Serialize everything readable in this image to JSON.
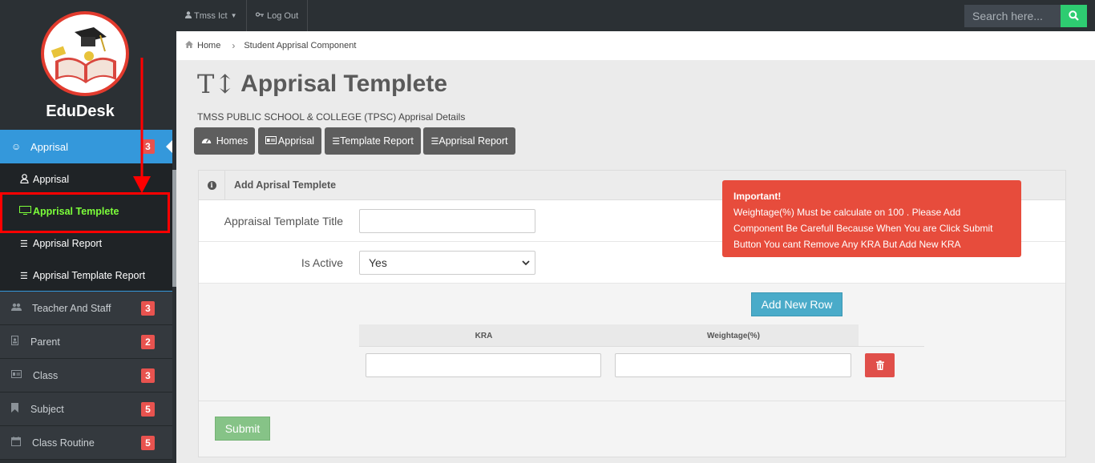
{
  "brand": {
    "name": "EduDesk"
  },
  "sidebar": {
    "active": {
      "label": "Apprisal",
      "badge": "3",
      "icon": "smile-icon"
    },
    "submenu": [
      {
        "label": "Apprisal",
        "icon": "user-icon"
      },
      {
        "label": "Apprisal Templete",
        "icon": "desktop-icon"
      },
      {
        "label": "Apprisal Report",
        "icon": "list-icon"
      },
      {
        "label": "Apprisal Template Report",
        "icon": "list-icon"
      }
    ],
    "items": [
      {
        "label": "Teacher And Staff",
        "badge": "3",
        "icon": "users-icon"
      },
      {
        "label": "Parent",
        "badge": "2",
        "icon": "contact-icon"
      },
      {
        "label": "Class",
        "badge": "3",
        "icon": "id-card-icon"
      },
      {
        "label": "Subject",
        "badge": "5",
        "icon": "bookmark-icon"
      },
      {
        "label": "Class Routine",
        "badge": "5",
        "icon": "calendar-icon"
      }
    ]
  },
  "topbar": {
    "user": "Tmss Ict",
    "logout": "Log Out",
    "search_placeholder": "Search here..."
  },
  "breadcrumb": {
    "home": "Home",
    "current": "Student Apprisal Component"
  },
  "page": {
    "title": "Apprisal Templete",
    "subtitle": "TMSS PUBLIC SCHOOL & COLLEGE (TPSC) Apprisal Details",
    "buttons": [
      "Homes",
      "Apprisal",
      "Template Report",
      "Apprisal Report"
    ]
  },
  "panel": {
    "title": "Add Aprisal Templete",
    "title_label": "Appraisal Template Title",
    "title_value": "",
    "active_label": "Is Active",
    "active_value": "Yes",
    "add_row": "Add New Row",
    "columns": [
      "KRA",
      "Weightage(%)"
    ],
    "submit": "Submit"
  },
  "alert": {
    "heading": "Important!",
    "lines": [
      "Weightage(%) Must be calculate on 100 . Please Add",
      "Component Be Carefull Because When You are Click Submit",
      "Button You cant Remove Any KRA But Add New KRA"
    ]
  },
  "colors": {
    "accent": "#3498db",
    "danger": "#e74c3c",
    "success": "#2ecc71",
    "sidebar": "#2b3034"
  }
}
